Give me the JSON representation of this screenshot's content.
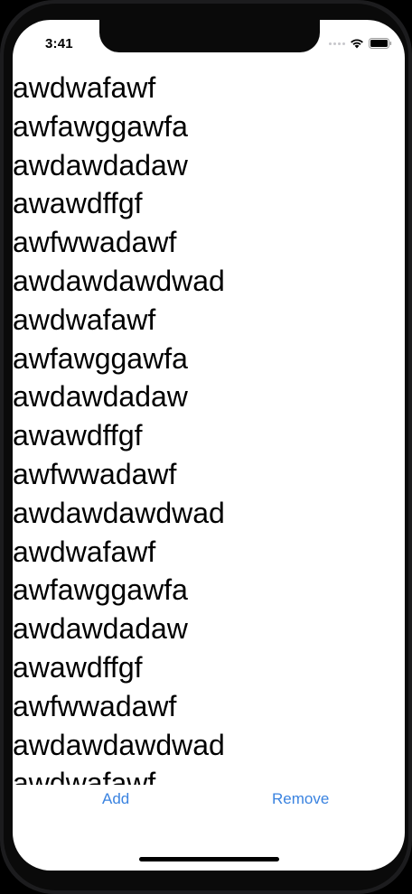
{
  "status_bar": {
    "time": "3:41",
    "wifi_icon": "wifi-icon",
    "battery_icon": "battery-icon"
  },
  "list": {
    "items": [
      "awdwafawf",
      "awfawggawfa",
      "awdawdadaw",
      "awawdffgf",
      "awfwwadawf",
      "awdawdawdwad",
      "awdwafawf",
      "awfawggawfa",
      "awdawdadaw",
      "awawdffgf",
      "awfwwadawf",
      "awdawdawdwad",
      "awdwafawf",
      "awfawggawfa",
      "awdawdadaw",
      "awawdffgf",
      "awfwwadawf",
      "awdawdawdwad",
      "awdwafawf"
    ]
  },
  "toolbar": {
    "add_label": "Add",
    "remove_label": "Remove"
  },
  "colors": {
    "accent": "#3a83e0",
    "text": "#000000",
    "background": "#ffffff"
  }
}
